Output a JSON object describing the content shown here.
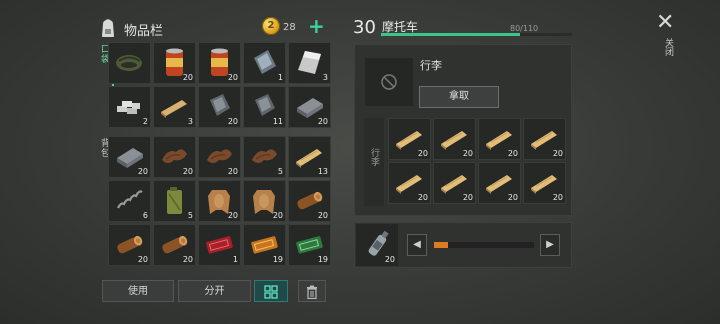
{
  "inventory": {
    "title": "物品栏",
    "coins": "28",
    "coin_glyph": "2",
    "add_symbol": "+",
    "tabs": {
      "pocket": "口袋",
      "backpack": "背包"
    },
    "pocket": [
      {
        "icon": "scarf-icon",
        "qty": ""
      },
      {
        "icon": "canned-food-icon",
        "qty": "20"
      },
      {
        "icon": "canned-food-icon",
        "qty": "20"
      },
      {
        "icon": "glass-icon",
        "qty": "1"
      },
      {
        "icon": "metal-sheet-icon",
        "qty": "3"
      },
      {
        "icon": "silver-bars-icon",
        "qty": "2"
      },
      {
        "icon": "wood-plank-icon",
        "qty": "3"
      },
      {
        "icon": "steel-plate-icon",
        "qty": "20"
      },
      {
        "icon": "steel-plate-icon",
        "qty": "11"
      },
      {
        "icon": "iron-ingot-icon",
        "qty": "20"
      }
    ],
    "backpack": [
      {
        "icon": "iron-ingot-icon",
        "qty": "20"
      },
      {
        "icon": "leather-icon",
        "qty": "20"
      },
      {
        "icon": "leather-icon",
        "qty": "20"
      },
      {
        "icon": "leather-icon",
        "qty": "5"
      },
      {
        "icon": "board-icon",
        "qty": "13"
      },
      {
        "icon": "spring-icon",
        "qty": "6"
      },
      {
        "icon": "jerrycan-icon",
        "qty": "5"
      },
      {
        "icon": "hide-icon",
        "qty": "20"
      },
      {
        "icon": "hide-icon",
        "qty": "20"
      },
      {
        "icon": "log-icon",
        "qty": "20"
      },
      {
        "icon": "log-icon",
        "qty": "20"
      },
      {
        "icon": "log-icon",
        "qty": "20"
      },
      {
        "icon": "red-ticket-icon",
        "qty": "1"
      },
      {
        "icon": "orange-ticket-icon",
        "qty": "19"
      },
      {
        "icon": "green-ticket-icon",
        "qty": "19"
      }
    ],
    "buttons": {
      "use": "使用",
      "split": "分开"
    }
  },
  "vehicle": {
    "level": "30",
    "name": "摩托车",
    "capacity": "80/110",
    "capacity_fraction": 0.727,
    "loot_label": "行李",
    "take_label": "拿取",
    "loot_tab": "行李",
    "loot_items": [
      {
        "icon": "board-icon",
        "qty": "20"
      },
      {
        "icon": "board-icon",
        "qty": "20"
      },
      {
        "icon": "board-icon",
        "qty": "20"
      },
      {
        "icon": "board-icon",
        "qty": "20"
      },
      {
        "icon": "board-icon",
        "qty": "20"
      },
      {
        "icon": "board-icon",
        "qty": "20"
      },
      {
        "icon": "board-icon",
        "qty": "20"
      },
      {
        "icon": "board-icon",
        "qty": "20"
      }
    ],
    "fuel": {
      "icon": "fuel-bottle-icon",
      "qty": "20",
      "level_fraction": 0.14,
      "prev": "◀",
      "next": "▶"
    }
  },
  "close": {
    "symbol": "✕",
    "label": "关闭"
  },
  "colors": {
    "accent": "#3ec388",
    "fuel": "#e07a22",
    "plank": "#d9b070"
  }
}
